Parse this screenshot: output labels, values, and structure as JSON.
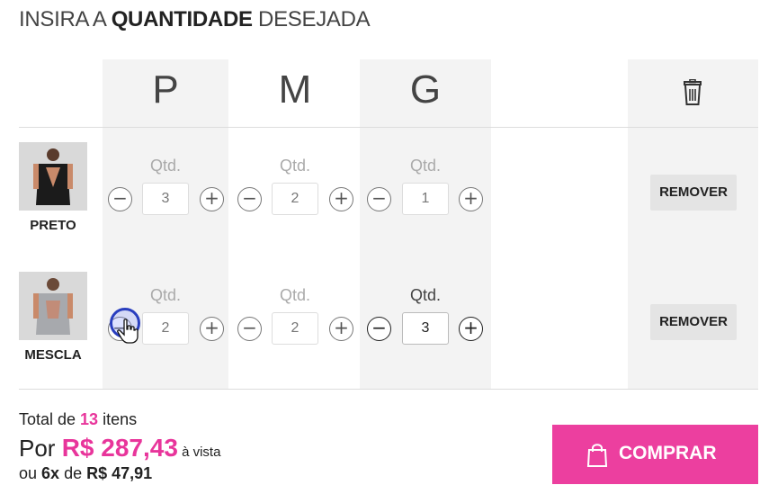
{
  "title": {
    "prefix": "INSIRA A ",
    "bold": "QUANTIDADE",
    "suffix": " DESEJADA"
  },
  "sizes": [
    "P",
    "M",
    "G"
  ],
  "qty_label": "Qtd.",
  "rows": [
    {
      "color_name": "PRETO",
      "quantities": [
        "3",
        "2",
        "1"
      ],
      "remove_label": "REMOVER",
      "thumb_colors": {
        "bg": "#d9d9d9",
        "shirt": "#1b1b1b"
      }
    },
    {
      "color_name": "MESCLA",
      "quantities": [
        "2",
        "2",
        "3"
      ],
      "remove_label": "REMOVER",
      "thumb_colors": {
        "bg": "#d9d9d9",
        "shirt": "#a7a9ad"
      }
    }
  ],
  "summary": {
    "total_prefix": "Total de ",
    "total_count": "13",
    "total_suffix": " itens",
    "por": "Por ",
    "price": "R$ 287,43",
    "vista": " à vista",
    "parc_prefix": "ou ",
    "parc_times": "6x",
    "parc_mid": " de ",
    "parc_value": "R$ 47,91"
  },
  "buy_label": "COMPRAR",
  "icons": {
    "trash": "trash-icon",
    "bag": "shopping-bag-icon",
    "minus": "minus-icon",
    "plus": "plus-icon"
  },
  "colors": {
    "accent": "#ec3f9f",
    "price": "#e8359b",
    "column_bg": "#f3f3f3"
  }
}
